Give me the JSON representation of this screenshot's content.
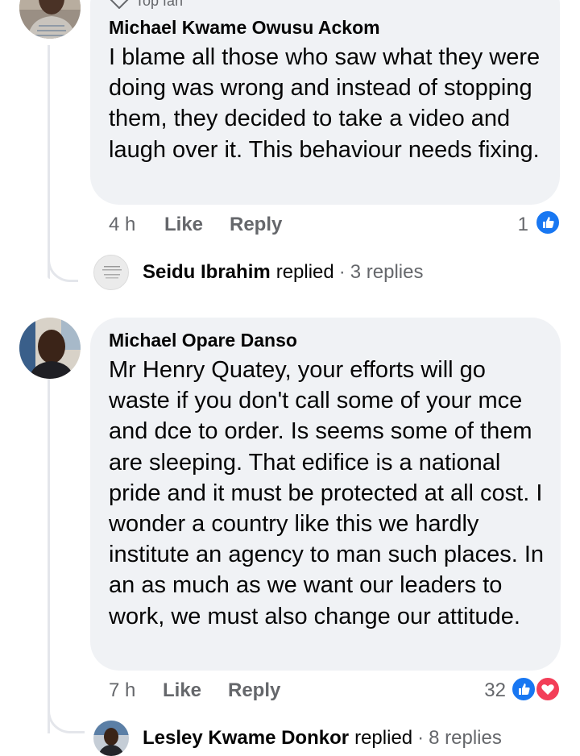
{
  "comments": [
    {
      "badge": "Top fan",
      "author": "Michael Kwame Owusu Ackom",
      "text": "I blame all those who saw what they were doing was wrong and instead of stopping them, they decided to take a video and laugh over it. This behaviour needs fixing.",
      "time": "4 h",
      "like_label": "Like",
      "reply_label": "Reply",
      "reaction_count": "1",
      "reactions": [
        "like"
      ],
      "reply_summary": {
        "name": "Seidu Ibrahim",
        "verb": "replied",
        "separator": "·",
        "count": "3 replies"
      }
    },
    {
      "author": "Michael Opare Danso",
      "text": "Mr Henry Quatey, your efforts will go waste if you don't call some of your mce and dce to order. Is seems some of them are sleeping. That  edifice is a national pride and it must be protected at all cost. I wonder a country like this we hardly institute an agency to man such places. In an as much as we want our leaders to work, we must also change our attitude.",
      "time": "7 h",
      "like_label": "Like",
      "reply_label": "Reply",
      "reaction_count": "32",
      "reactions": [
        "like",
        "love"
      ],
      "reply_summary": {
        "name": "Lesley Kwame Donkor",
        "verb": "replied",
        "separator": "·",
        "count": "8 replies"
      }
    }
  ],
  "colors": {
    "bubble": "#f0f2f5",
    "secondary_text": "#65676b",
    "like_blue": "#1877f2",
    "love_red": "#f33e58",
    "thread_line": "#e4e6eb"
  }
}
